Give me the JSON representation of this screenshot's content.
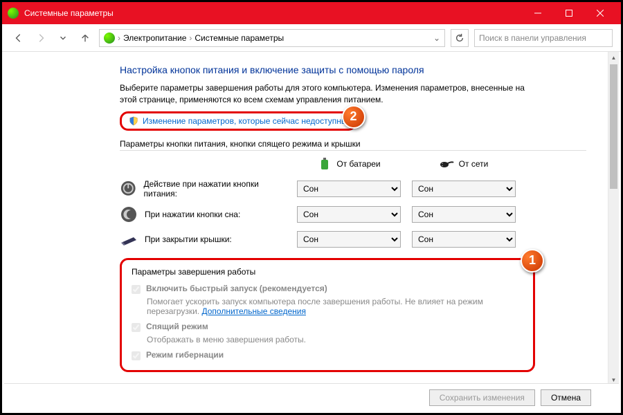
{
  "window": {
    "title": "Системные параметры"
  },
  "breadcrumb": {
    "item1": "Электропитание",
    "item2": "Системные параметры"
  },
  "search": {
    "placeholder": "Поиск в панели управления"
  },
  "page": {
    "heading": "Настройка кнопок питания и включение защиты с помощью пароля",
    "description": "Выберите параметры завершения работы для этого компьютера. Изменения параметров, внесенные на этой странице, применяются ко всем схемам управления питанием.",
    "unlock_link": "Изменение параметров, которые сейчас недоступны",
    "section_title": "Параметры кнопки питания, кнопки спящего режима и крышки",
    "col_battery": "От батареи",
    "col_ac": "От сети",
    "row_power": "Действие при нажатии кнопки питания:",
    "row_sleep": "При нажатии кнопки сна:",
    "row_lid": "При закрытии крышки:",
    "option_sleep": "Сон",
    "shutdown_title": "Параметры завершения работы",
    "fast_startup_label": "Включить быстрый запуск (рекомендуется)",
    "fast_startup_desc": "Помогает ускорить запуск компьютера после завершения работы. Не влияет на режим перезагрузки.",
    "more_info": "Дополнительные сведения",
    "sleep_label": "Спящий режим",
    "sleep_desc": "Отображать в меню завершения работы.",
    "hibernate_label": "Режим гибернации"
  },
  "footer": {
    "save": "Сохранить изменения",
    "cancel": "Отмена"
  },
  "badges": {
    "one": "1",
    "two": "2"
  }
}
